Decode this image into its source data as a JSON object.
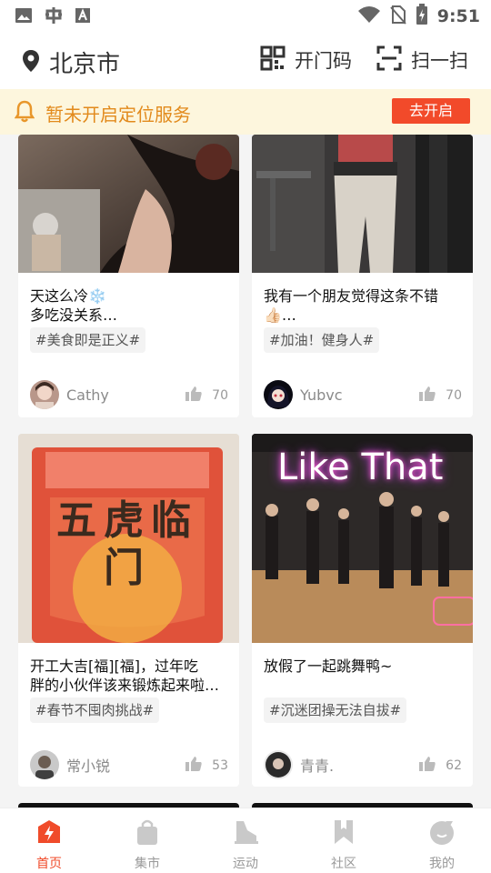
{
  "status_bar": {
    "time": "9:51"
  },
  "header": {
    "city": "北京市",
    "open_door_code_label": "开门码",
    "scan_label": "扫一扫"
  },
  "notice": {
    "text": "暂未开启定位服务",
    "button_label": "去开启"
  },
  "feed": {
    "posts": [
      {
        "title": "天这么冷❄️\n多吃没关系…",
        "tag": "#美食即是正义#",
        "user": "Cathy",
        "likes": "70"
      },
      {
        "title": "我有一个朋友觉得这条不错\n👍🏻…",
        "tag": "#加油！健身人#",
        "user": "Yubvc",
        "likes": "70"
      },
      {
        "title": "开工大吉[福][福]，过年吃\n胖的小伙伴该来锻炼起来啦…",
        "tag": "#春节不囤肉挑战#",
        "user": "常小锐",
        "likes": "53",
        "image_text": "五虎临门"
      },
      {
        "title": "放假了一起跳舞鸭~",
        "tag": "#沉迷团操无法自拔#",
        "user": "青青.",
        "likes": "62",
        "image_text": "Like That"
      }
    ]
  },
  "tabbar": {
    "tabs": [
      {
        "label": "首页"
      },
      {
        "label": "集市"
      },
      {
        "label": "运动"
      },
      {
        "label": "社区"
      },
      {
        "label": "我的"
      }
    ]
  },
  "colors": {
    "accent": "#f04b2a",
    "notice_text": "#e28a1c",
    "notice_bg": "#fdf6dd"
  }
}
